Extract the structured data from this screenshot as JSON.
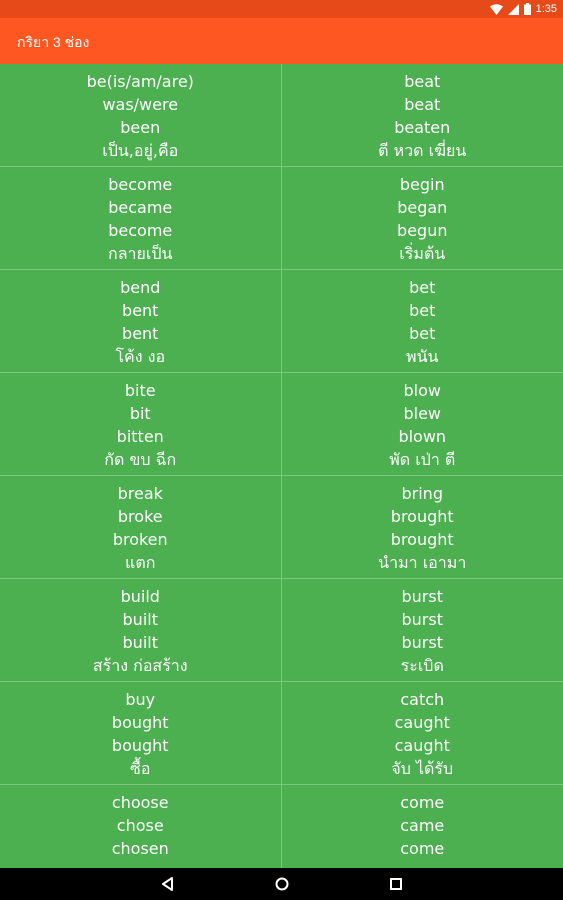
{
  "status_bar": {
    "time": "1:35",
    "icons": [
      "wifi-icon",
      "signal-icon",
      "battery-icon"
    ]
  },
  "app_bar": {
    "title": "กริยา 3 ช่อง"
  },
  "rows": [
    {
      "left": {
        "v1": "be(is/am/are)",
        "v2": "was/were",
        "v3": "been",
        "meaning": "เป็น,อยู่,คือ"
      },
      "right": {
        "v1": "beat",
        "v2": "beat",
        "v3": "beaten",
        "meaning": "ตี หวด เฆี่ยน"
      }
    },
    {
      "left": {
        "v1": "become",
        "v2": "became",
        "v3": "become",
        "meaning": "กลายเป็น"
      },
      "right": {
        "v1": "begin",
        "v2": "began",
        "v3": "begun",
        "meaning": "เริ่มต้น"
      }
    },
    {
      "left": {
        "v1": "bend",
        "v2": "bent",
        "v3": "bent",
        "meaning": "โค้ง งอ"
      },
      "right": {
        "v1": "bet",
        "v2": "bet",
        "v3": "bet",
        "meaning": "พนัน"
      }
    },
    {
      "left": {
        "v1": "bite",
        "v2": "bit",
        "v3": "bitten",
        "meaning": "กัด ขบ ฉีก"
      },
      "right": {
        "v1": "blow",
        "v2": "blew",
        "v3": "blown",
        "meaning": "พัด เป่า ตี"
      }
    },
    {
      "left": {
        "v1": "break",
        "v2": "broke",
        "v3": "broken",
        "meaning": "แตก"
      },
      "right": {
        "v1": "bring",
        "v2": "brought",
        "v3": "brought",
        "meaning": "นำมา เอามา"
      }
    },
    {
      "left": {
        "v1": "build",
        "v2": "built",
        "v3": "built",
        "meaning": "สร้าง ก่อสร้าง"
      },
      "right": {
        "v1": "burst",
        "v2": "burst",
        "v3": "burst",
        "meaning": "ระเบิด"
      }
    },
    {
      "left": {
        "v1": "buy",
        "v2": "bought",
        "v3": "bought",
        "meaning": "ซื้อ"
      },
      "right": {
        "v1": "catch",
        "v2": "caught",
        "v3": "caught",
        "meaning": "จับ ได้รับ"
      }
    },
    {
      "left": {
        "v1": "choose",
        "v2": "chose",
        "v3": "chosen",
        "meaning": ""
      },
      "right": {
        "v1": "come",
        "v2": "came",
        "v3": "come",
        "meaning": ""
      }
    }
  ],
  "nav_bar": {
    "buttons": [
      "back-icon",
      "home-icon",
      "recents-icon"
    ]
  },
  "colors": {
    "status_bar": "#e64a19",
    "app_bar": "#ff5722",
    "list_background": "#4caf50",
    "nav_bar": "#000000",
    "text": "#ffffff"
  }
}
